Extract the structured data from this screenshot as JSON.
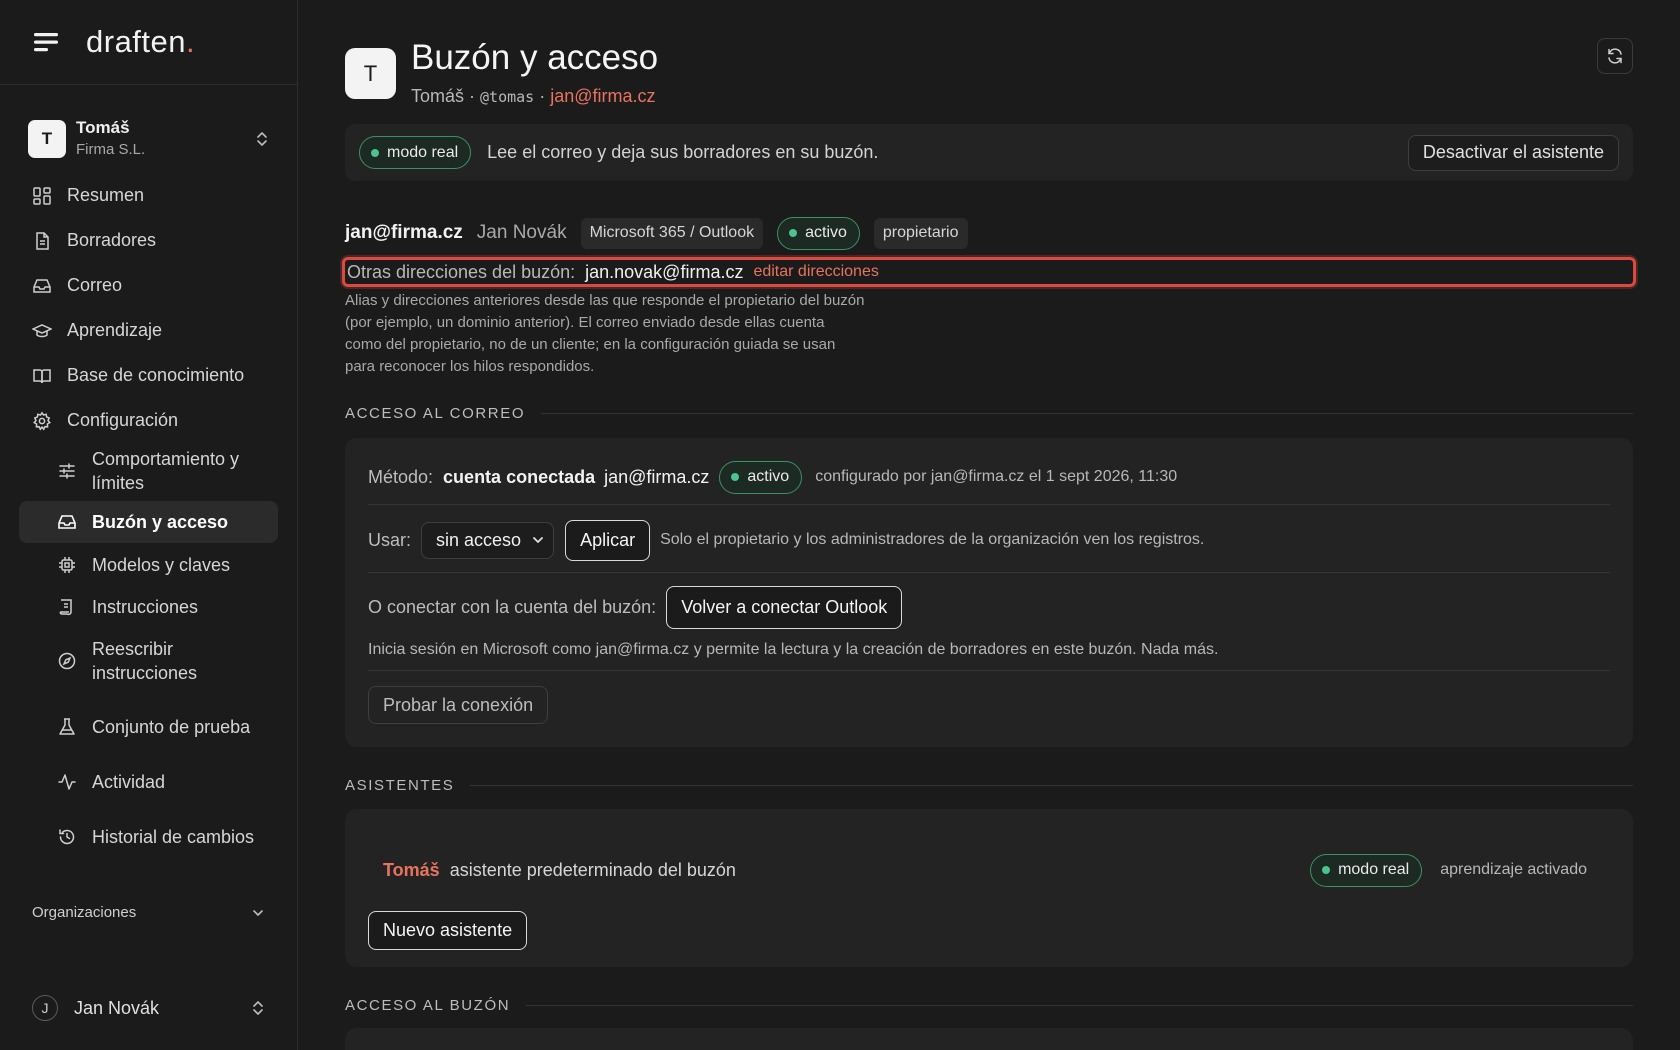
{
  "brand": {
    "name": "draften",
    "dot": "."
  },
  "workspace": {
    "avatar": "T",
    "name": "Tomáš",
    "org": "Firma S.L."
  },
  "nav": {
    "items": [
      {
        "label": "Resumen"
      },
      {
        "label": "Borradores"
      },
      {
        "label": "Correo"
      },
      {
        "label": "Aprendizaje"
      },
      {
        "label": "Base de conocimiento"
      },
      {
        "label": "Configuración"
      }
    ],
    "sub": [
      {
        "label": "Comportamiento y límites"
      },
      {
        "label": "Buzón y acceso"
      },
      {
        "label": "Modelos y claves"
      },
      {
        "label": "Instrucciones"
      },
      {
        "label": "Reescribir instrucciones"
      },
      {
        "label": "Conjunto de prueba"
      },
      {
        "label": "Actividad"
      },
      {
        "label": "Historial de cambios"
      }
    ],
    "orgs_label": "Organizaciones"
  },
  "user": {
    "avatar": "J",
    "name": "Jan Novák"
  },
  "header": {
    "avatar": "T",
    "title": "Buzón y acceso",
    "name": "Tomáš",
    "sep": " · ",
    "handle": "@tomas",
    "email": "jan@firma.cz"
  },
  "mode": {
    "pill": "modo real",
    "description": "Lee el correo y deja sus borradores en su buzón.",
    "deactivate": "Desactivar el asistente"
  },
  "account": {
    "address": "jan@firma.cz",
    "person": "Jan Novák",
    "provider": "Microsoft 365 / Outlook",
    "status": "activo",
    "role": "propietario",
    "alias_label": "Otras direcciones del buzón:",
    "alias_value": "jan.novak@firma.cz",
    "alias_edit": "editar direcciones",
    "help": "Alias y direcciones anteriores desde las que responde el propietario del buzón (por ejemplo, un dominio anterior). El correo enviado desde ellas cuenta como del propietario, no de un cliente; en la configuración guiada se usan para reconocer los hilos respondidos."
  },
  "mail_access": {
    "heading": "ACCESO AL CORREO",
    "method_label": "Método:",
    "method_value": "cuenta conectada",
    "method_email": "jan@firma.cz",
    "status": "activo",
    "configured": "configurado por jan@firma.cz el 1 sept 2026, 11:30",
    "use_label": "Usar:",
    "use_value": "sin acceso",
    "apply": "Aplicar",
    "use_note": "Solo el propietario y los administradores de la organización ven los registros.",
    "connect_label": "O conectar con la cuenta del buzón:",
    "reconnect": "Volver a conectar Outlook",
    "connect_note": "Inicia sesión en Microsoft como jan@firma.cz y permite la lectura y la creación de borradores en este buzón. Nada más.",
    "test": "Probar la conexión"
  },
  "assistants": {
    "heading": "ASISTENTES",
    "name": "Tomáš",
    "description": "asistente predeterminado del buzón",
    "mode": "modo real",
    "learning": "aprendizaje activado",
    "new": "Nuevo asistente"
  },
  "mailbox_access": {
    "heading": "ACCESO AL BUZÓN"
  },
  "colors": {
    "accent": "#e8735f",
    "green": "#4cc38a",
    "highlight": "#d94b3f"
  }
}
